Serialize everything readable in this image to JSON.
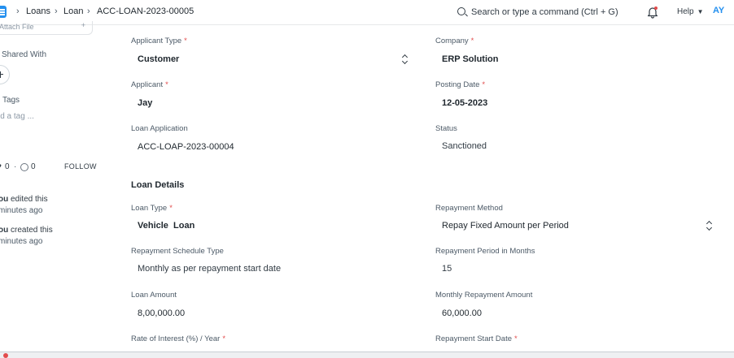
{
  "navbar": {
    "breadcrumbs": [
      "Loans",
      "Loan",
      "ACC-LOAN-2023-00005"
    ],
    "search_placeholder": "Search or type a command (Ctrl + G)",
    "help_label": "Help",
    "avatar_initials": "AY"
  },
  "sidebar": {
    "attach_partial": "Attach File",
    "shared_with_label": "Shared With",
    "tags_label": "Tags",
    "add_tag_label": "ld a tag ...",
    "likes_count": "0",
    "comments_count": "0",
    "follow_label": "FOLLOW",
    "activity": [
      {
        "line1_bold": "ou",
        "line1_rest": " edited this",
        "line2": "minutes ago"
      },
      {
        "line1_bold": "ou",
        "line1_rest": " created this",
        "line2": " minutes ago"
      }
    ]
  },
  "form": {
    "applicant_type": {
      "label": "Applicant Type",
      "value": "Customer"
    },
    "company": {
      "label": "Company",
      "value": "ERP Solution"
    },
    "applicant": {
      "label": "Applicant",
      "value": "Jay"
    },
    "posting_date": {
      "label": "Posting Date",
      "value": "12-05-2023"
    },
    "loan_application": {
      "label": "Loan Application",
      "value": "ACC-LOAP-2023-00004"
    },
    "status": {
      "label": "Status",
      "value": "Sanctioned"
    },
    "section_title": "Loan Details",
    "loan_type": {
      "label": "Loan Type",
      "value": "Vehicle  Loan"
    },
    "repayment_method": {
      "label": "Repayment Method",
      "value": "Repay Fixed Amount per Period"
    },
    "repayment_schedule_type": {
      "label": "Repayment Schedule Type",
      "value": "Monthly as per repayment start date"
    },
    "repayment_period": {
      "label": "Repayment Period in Months",
      "value": "15"
    },
    "loan_amount": {
      "label": "Loan Amount",
      "value": "8,00,000.00"
    },
    "monthly_repayment": {
      "label": "Monthly Repayment Amount",
      "value": "60,000.00"
    },
    "rate_of_interest": {
      "label": "Rate of Interest (%) / Year"
    },
    "repayment_start_date": {
      "label": "Repayment Start Date"
    },
    "required_marker": "*"
  },
  "colors": {
    "accent": "#2490ef",
    "required": "#e24c4c"
  }
}
